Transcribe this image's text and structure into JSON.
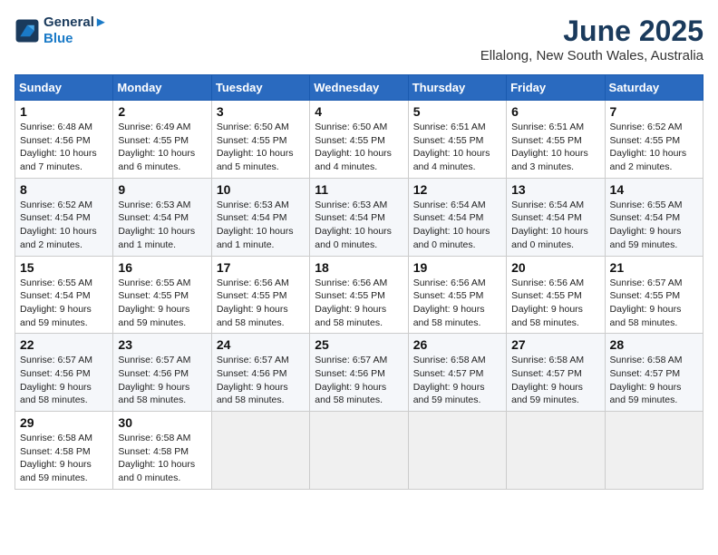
{
  "logo": {
    "line1": "General",
    "line2": "Blue"
  },
  "title": "June 2025",
  "subtitle": "Ellalong, New South Wales, Australia",
  "days_of_week": [
    "Sunday",
    "Monday",
    "Tuesday",
    "Wednesday",
    "Thursday",
    "Friday",
    "Saturday"
  ],
  "weeks": [
    [
      {
        "day": "1",
        "sunrise": "6:48 AM",
        "sunset": "4:56 PM",
        "daylight": "10 hours and 7 minutes."
      },
      {
        "day": "2",
        "sunrise": "6:49 AM",
        "sunset": "4:55 PM",
        "daylight": "10 hours and 6 minutes."
      },
      {
        "day": "3",
        "sunrise": "6:50 AM",
        "sunset": "4:55 PM",
        "daylight": "10 hours and 5 minutes."
      },
      {
        "day": "4",
        "sunrise": "6:50 AM",
        "sunset": "4:55 PM",
        "daylight": "10 hours and 4 minutes."
      },
      {
        "day": "5",
        "sunrise": "6:51 AM",
        "sunset": "4:55 PM",
        "daylight": "10 hours and 4 minutes."
      },
      {
        "day": "6",
        "sunrise": "6:51 AM",
        "sunset": "4:55 PM",
        "daylight": "10 hours and 3 minutes."
      },
      {
        "day": "7",
        "sunrise": "6:52 AM",
        "sunset": "4:55 PM",
        "daylight": "10 hours and 2 minutes."
      }
    ],
    [
      {
        "day": "8",
        "sunrise": "6:52 AM",
        "sunset": "4:54 PM",
        "daylight": "10 hours and 2 minutes."
      },
      {
        "day": "9",
        "sunrise": "6:53 AM",
        "sunset": "4:54 PM",
        "daylight": "10 hours and 1 minute."
      },
      {
        "day": "10",
        "sunrise": "6:53 AM",
        "sunset": "4:54 PM",
        "daylight": "10 hours and 1 minute."
      },
      {
        "day": "11",
        "sunrise": "6:53 AM",
        "sunset": "4:54 PM",
        "daylight": "10 hours and 0 minutes."
      },
      {
        "day": "12",
        "sunrise": "6:54 AM",
        "sunset": "4:54 PM",
        "daylight": "10 hours and 0 minutes."
      },
      {
        "day": "13",
        "sunrise": "6:54 AM",
        "sunset": "4:54 PM",
        "daylight": "10 hours and 0 minutes."
      },
      {
        "day": "14",
        "sunrise": "6:55 AM",
        "sunset": "4:54 PM",
        "daylight": "9 hours and 59 minutes."
      }
    ],
    [
      {
        "day": "15",
        "sunrise": "6:55 AM",
        "sunset": "4:54 PM",
        "daylight": "9 hours and 59 minutes."
      },
      {
        "day": "16",
        "sunrise": "6:55 AM",
        "sunset": "4:55 PM",
        "daylight": "9 hours and 59 minutes."
      },
      {
        "day": "17",
        "sunrise": "6:56 AM",
        "sunset": "4:55 PM",
        "daylight": "9 hours and 58 minutes."
      },
      {
        "day": "18",
        "sunrise": "6:56 AM",
        "sunset": "4:55 PM",
        "daylight": "9 hours and 58 minutes."
      },
      {
        "day": "19",
        "sunrise": "6:56 AM",
        "sunset": "4:55 PM",
        "daylight": "9 hours and 58 minutes."
      },
      {
        "day": "20",
        "sunrise": "6:56 AM",
        "sunset": "4:55 PM",
        "daylight": "9 hours and 58 minutes."
      },
      {
        "day": "21",
        "sunrise": "6:57 AM",
        "sunset": "4:55 PM",
        "daylight": "9 hours and 58 minutes."
      }
    ],
    [
      {
        "day": "22",
        "sunrise": "6:57 AM",
        "sunset": "4:56 PM",
        "daylight": "9 hours and 58 minutes."
      },
      {
        "day": "23",
        "sunrise": "6:57 AM",
        "sunset": "4:56 PM",
        "daylight": "9 hours and 58 minutes."
      },
      {
        "day": "24",
        "sunrise": "6:57 AM",
        "sunset": "4:56 PM",
        "daylight": "9 hours and 58 minutes."
      },
      {
        "day": "25",
        "sunrise": "6:57 AM",
        "sunset": "4:56 PM",
        "daylight": "9 hours and 58 minutes."
      },
      {
        "day": "26",
        "sunrise": "6:58 AM",
        "sunset": "4:57 PM",
        "daylight": "9 hours and 59 minutes."
      },
      {
        "day": "27",
        "sunrise": "6:58 AM",
        "sunset": "4:57 PM",
        "daylight": "9 hours and 59 minutes."
      },
      {
        "day": "28",
        "sunrise": "6:58 AM",
        "sunset": "4:57 PM",
        "daylight": "9 hours and 59 minutes."
      }
    ],
    [
      {
        "day": "29",
        "sunrise": "6:58 AM",
        "sunset": "4:58 PM",
        "daylight": "9 hours and 59 minutes."
      },
      {
        "day": "30",
        "sunrise": "6:58 AM",
        "sunset": "4:58 PM",
        "daylight": "10 hours and 0 minutes."
      },
      null,
      null,
      null,
      null,
      null
    ]
  ],
  "labels": {
    "sunrise": "Sunrise: ",
    "sunset": "Sunset: ",
    "daylight": "Daylight: "
  }
}
